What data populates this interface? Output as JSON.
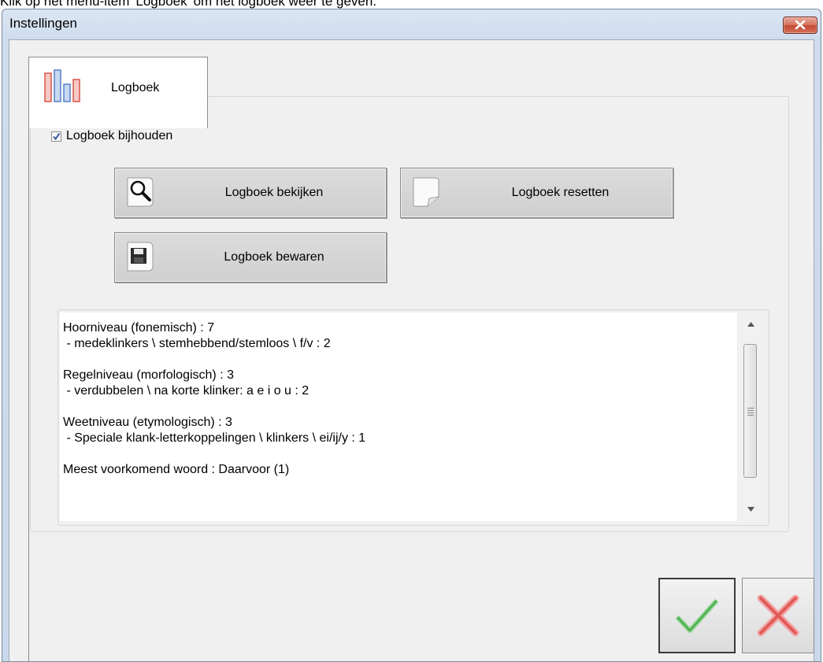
{
  "caption": "Klik op het menu-item 'Logboek' om het logboek weer te geven.",
  "window": {
    "title": "Instellingen"
  },
  "tabs": [
    {
      "label": "Logboek",
      "icon": "bar-chart-icon"
    }
  ],
  "settings": {
    "keep_log_label": "Logboek bijhouden",
    "keep_log_checked": true
  },
  "buttons": {
    "view_label": "Logboek bekijken",
    "reset_label": "Logboek resetten",
    "save_label": "Logboek bewaren"
  },
  "log_lines": [
    "Hoorniveau (fonemisch) : 7",
    " - medeklinkers \\ stemhebbend/stemloos \\ f/v : 2",
    "",
    "Regelniveau (morfologisch) : 3",
    " - verdubbelen \\ na korte klinker: a e i o u : 2",
    "",
    "Weetniveau (etymologisch) : 3",
    " - Speciale klank-letterkoppelingen \\ klinkers \\ ei/ij/y : 1",
    "",
    "Meest voorkomend woord : Daarvoor (1)"
  ],
  "colors": {
    "ok_check": "#6cc26c",
    "cancel_x": "#e25a5a",
    "close_button": "#c94a35"
  }
}
